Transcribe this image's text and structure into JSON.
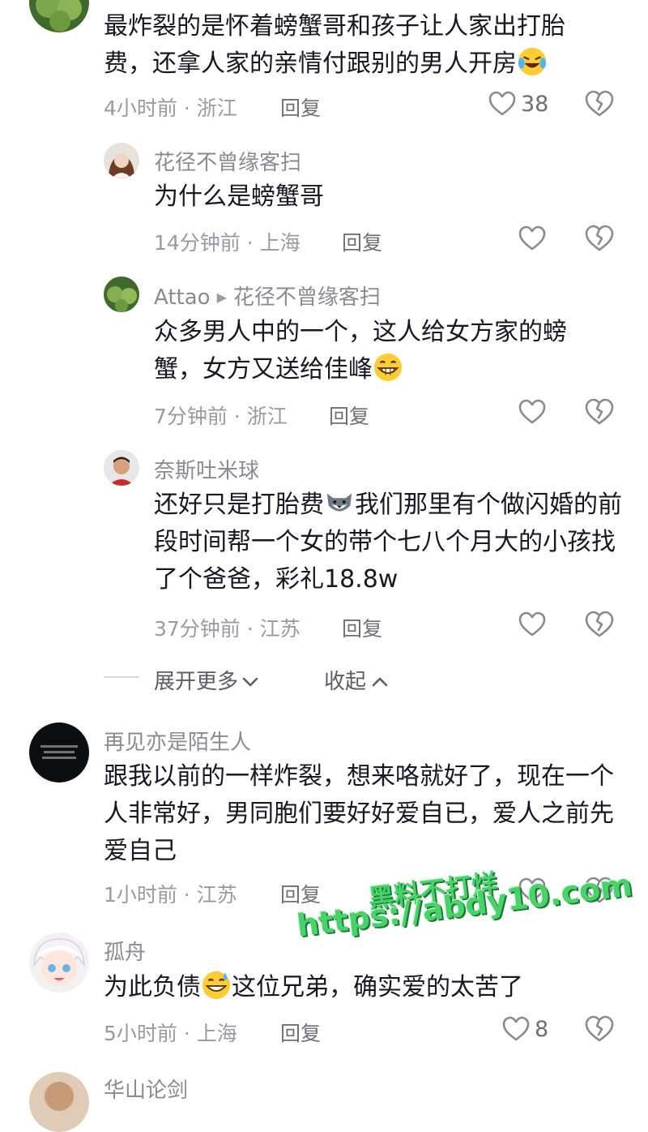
{
  "comments": [
    {
      "text": "最炸裂的是怀着螃蟹哥和孩子让人家出打胎费，还拿人家的亲情付跟别的男人开房",
      "meta": "4小时前 · 浙江",
      "reply": "回复",
      "likes": "38"
    },
    {
      "name": "花径不曾缘客扫",
      "text": "为什么是螃蟹哥",
      "meta": "14分钟前 · 上海",
      "reply": "回复"
    },
    {
      "name": "Attao",
      "reply_to": "花径不曾缘客扫",
      "text": "众多男人中的一个，这人给女方家的螃蟹，女方又送给佳峰",
      "meta": "7分钟前 · 浙江",
      "reply": "回复"
    },
    {
      "name": "奈斯吐米球",
      "text_a": "还好只是打胎费",
      "text_b": "我们那里有个做闪婚的前段时间帮一个女的带个七八个月大的小孩找了个爸爸，彩礼18.8w",
      "meta": "37分钟前 · 江苏",
      "reply": "回复"
    },
    {
      "name": "再见亦是陌生人",
      "text": "跟我以前的一样炸裂，想来咯就好了，现在一个人非常好，男同胞们要好好爱自已，爱人之前先爱自己",
      "meta": "1小时前 · 江苏",
      "reply": "回复"
    },
    {
      "name": "孤舟",
      "text_a": "为此负债",
      "text_b": "这位兄弟，确实爱的太苦了",
      "meta": "5小时前 · 上海",
      "reply": "回复",
      "likes": "8"
    },
    {
      "name": "华山论剑"
    }
  ],
  "expand": {
    "more": "展开更多",
    "collapse": "收起"
  },
  "watermark": {
    "line1": "黑料不打烊",
    "line2": "https://abdy10.com"
  },
  "colors": {
    "text": "#161823",
    "meta": "#9a9ba0",
    "watermark": "#49d26a"
  }
}
